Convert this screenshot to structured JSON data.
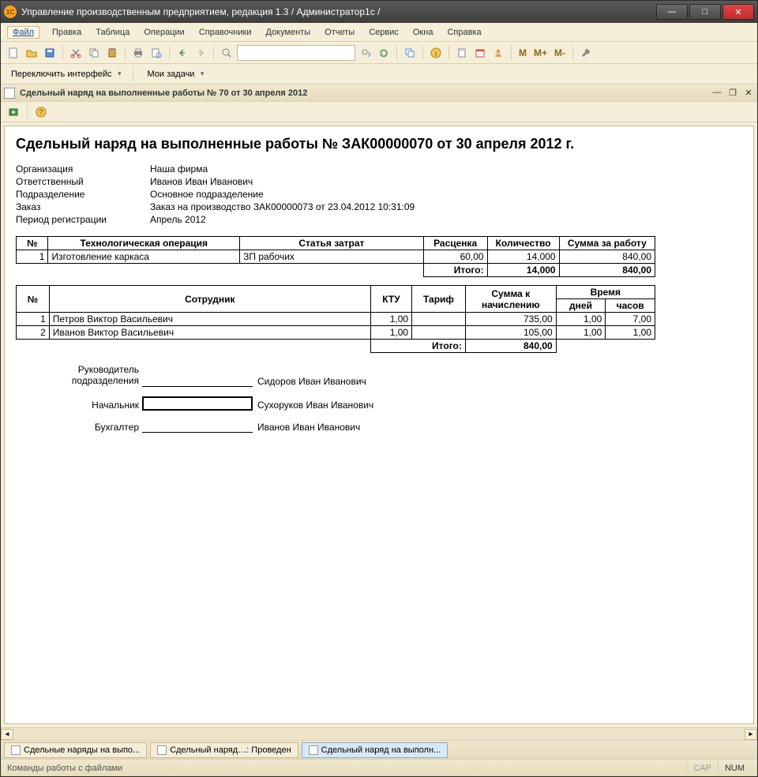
{
  "window_title": "Управление производственным предприятием, редакция 1.3 / Администратор1с /",
  "menu": {
    "file": "Файл",
    "edit": "Правка",
    "table": "Таблица",
    "ops": "Операции",
    "refs": "Справочники",
    "docs": "Документы",
    "reports": "Отчеты",
    "service": "Сервис",
    "windows": "Окна",
    "help": "Справка"
  },
  "toolbar2": {
    "switch": "Переключить интерфейс",
    "tasks": "Мои задачи"
  },
  "m_labels": {
    "m": "M",
    "mp": "M+",
    "mm": "M-"
  },
  "doc_title": "Сдельный наряд на выполненные работы № 70 от 30 апреля 2012",
  "report": {
    "heading": "Сдельный наряд на выполненные работы № ЗАК00000070 от 30 апреля 2012 г.",
    "meta": {
      "org_l": "Организация",
      "org_v": "Наша фирма",
      "resp_l": "Ответственный",
      "resp_v": "Иванов Иван Иванович",
      "dept_l": "Подразделение",
      "dept_v": "Основное подразделение",
      "order_l": "Заказ",
      "order_v": "Заказ на производство ЗАК00000073 от 23.04.2012 10:31:09",
      "period_l": "Период регистрации",
      "period_v": "Апрель 2012"
    },
    "t1": {
      "h_num": "№",
      "h_op": "Технологическая операция",
      "h_cost": "Статья затрат",
      "h_rate": "Расценка",
      "h_qty": "Количество",
      "h_sum": "Сумма за работу",
      "r1_num": "1",
      "r1_op": "Изготовление каркаса",
      "r1_cost": "ЗП рабочих",
      "r1_rate": "60,00",
      "r1_qty": "14,000",
      "r1_sum": "840,00",
      "total_l": "Итого:",
      "total_qty": "14,000",
      "total_sum": "840,00"
    },
    "t2": {
      "h_num": "№",
      "h_emp": "Сотрудник",
      "h_ktu": "КТУ",
      "h_tarif": "Тариф",
      "h_sum": "Сумма к начислению",
      "h_time": "Время",
      "h_days": "дней",
      "h_hours": "часов",
      "r1_num": "1",
      "r1_emp": "Петров Виктор Васильевич",
      "r1_ktu": "1,00",
      "r1_tarif": "",
      "r1_sum": "735,00",
      "r1_days": "1,00",
      "r1_hours": "7,00",
      "r2_num": "2",
      "r2_emp": "Иванов Виктор Васильевич",
      "r2_ktu": "1,00",
      "r2_tarif": "",
      "r2_sum": "105,00",
      "r2_days": "1,00",
      "r2_hours": "1,00",
      "total_l": "Итого:",
      "total_sum": "840,00"
    },
    "signatures": {
      "head_l": "Руководитель подразделения",
      "head_n": "Сидоров Иван Иванович",
      "chief_l": "Начальник",
      "chief_n": "Сухоруков Иван Иванович",
      "acc_l": "Бухгалтер",
      "acc_n": "Иванов Иван Иванович"
    }
  },
  "tabs": {
    "t1": "Сдельные наряды на выпо...",
    "t2": "Сдельный наряд…: Проведен",
    "t3": "Сдельный наряд на выполн..."
  },
  "status": {
    "left": "Команды работы с файлами",
    "cap": "CAP",
    "num": "NUM"
  }
}
